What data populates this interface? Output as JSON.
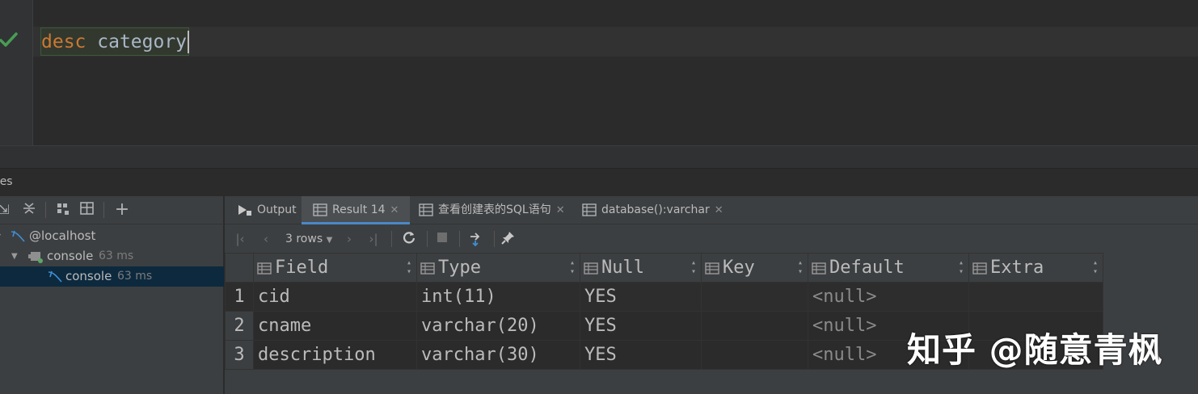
{
  "editor": {
    "keyword": "desc",
    "identifier": "category",
    "status_icon": "checkmark-icon"
  },
  "services": {
    "title": "ces",
    "tree": [
      {
        "label": "@localhost",
        "time": ""
      },
      {
        "label": "console",
        "time": "63 ms"
      },
      {
        "label": "console",
        "time": "63 ms"
      }
    ]
  },
  "results": {
    "tabs": [
      {
        "label": "Output",
        "icon": "output-icon",
        "closable": false
      },
      {
        "label": "Result 14",
        "icon": "table-icon",
        "closable": true
      },
      {
        "label": "查看创建表的SQL语句",
        "icon": "table-icon",
        "closable": true
      },
      {
        "label": "database():varchar",
        "icon": "table-icon",
        "closable": true
      }
    ],
    "rows_label": "3 rows",
    "columns": [
      "Field",
      "Type",
      "Null",
      "Key",
      "Default",
      "Extra"
    ],
    "rows": [
      {
        "num": "1",
        "cells": [
          "cid",
          "int(11)",
          "YES",
          "",
          "<null>",
          ""
        ]
      },
      {
        "num": "2",
        "cells": [
          "cname",
          "varchar(20)",
          "YES",
          "",
          "<null>",
          ""
        ]
      },
      {
        "num": "3",
        "cells": [
          "description",
          "varchar(30)",
          "YES",
          "",
          "<null>",
          ""
        ]
      }
    ]
  },
  "watermark": "知乎 @随意青枫",
  "colors": {
    "keyword": "#cc7832",
    "identifier": "#a9b7c6",
    "success": "#499c54",
    "selection": "#0d293e"
  }
}
